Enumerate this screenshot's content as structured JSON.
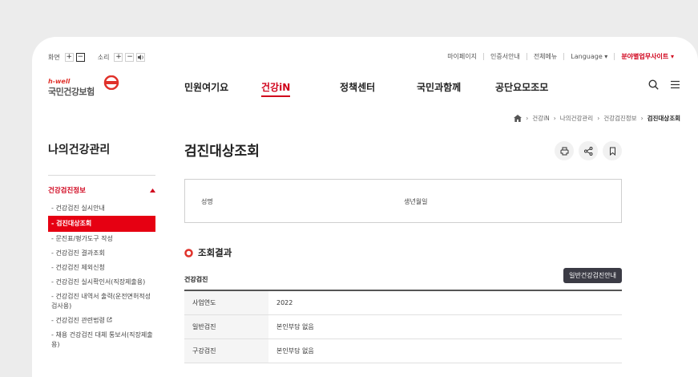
{
  "util": {
    "screen_label": "화면",
    "sound_label": "소리",
    "plus": "+",
    "minus": "−",
    "links": [
      "마이페이지",
      "인증서안내",
      "전체메뉴",
      "Language ▾"
    ],
    "site_link": "분야별업무사이트 ▾"
  },
  "logo": {
    "sub": "h-well",
    "name": "국민건강보험"
  },
  "gnb": [
    "민원여기요",
    "건강iN",
    "정책센터",
    "국민과함께",
    "공단요모조모"
  ],
  "breadcrumb": [
    "건강iN",
    "나의건강관리",
    "건강검진정보",
    "검진대상조회"
  ],
  "sidebar": {
    "title": "나의건강관리",
    "group": "건강검진정보",
    "items": [
      "건강검진 실시안내",
      "검진대상조회",
      "문진표/평가도구 작성",
      "건강검진 결과조회",
      "건강검진 제외신청",
      "건강검진 실시확인서(직장제출용)",
      "건강검진 내역서 출력(운전면허적성검사용)",
      "건강검진 관련법령",
      "채용 건강검진 대체 통보서(직장제출용)"
    ]
  },
  "main": {
    "title": "검진대상조회",
    "field_name": "성명",
    "field_birth": "생년월일",
    "section_title": "조회결과",
    "sub_title": "건강검진",
    "guide_button": "일반건강검진안내",
    "rows": [
      {
        "label": "사업연도",
        "value": "2022"
      },
      {
        "label": "일반검진",
        "value": "본인부담 없음"
      },
      {
        "label": "구강검진",
        "value": "본인부담 없음"
      }
    ]
  },
  "colors": {
    "accent": "#d0021b",
    "button_dark": "#3b3b45"
  }
}
